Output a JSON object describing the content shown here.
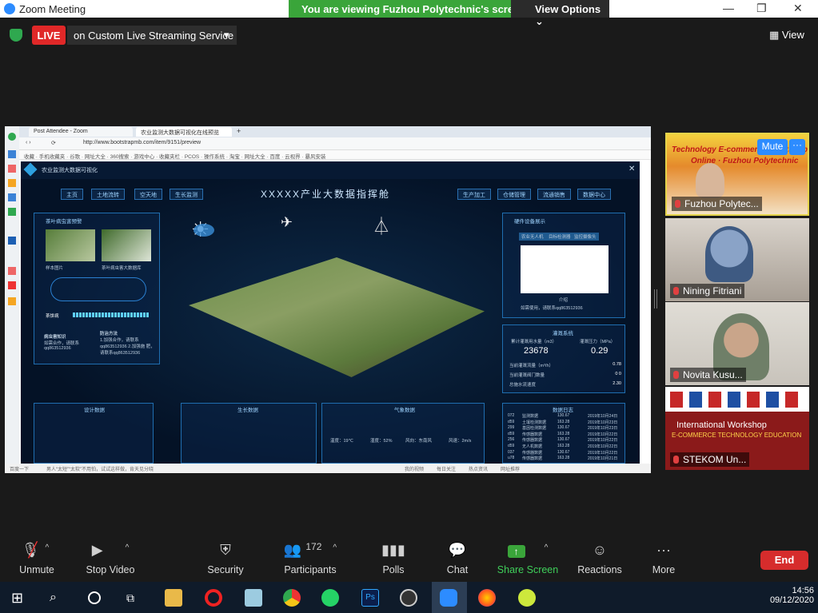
{
  "window": {
    "title": "Zoom Meeting",
    "viewing_banner": "You are viewing Fuzhou Polytechnic's screen",
    "view_options": "View Options",
    "view_button": "View"
  },
  "live": {
    "badge": "LIVE",
    "service": "on Custom Live Streaming Service"
  },
  "browser": {
    "tabs": [
      "Post Attendee - Zoom",
      "农业监测大数据可视化在线预览"
    ],
    "url": "http://www.bootstrapmb.com/item/9151/preview",
    "bookmarks": [
      "收藏",
      "手机收藏夹",
      "谷歌",
      "网址大全",
      "360搜索",
      "游戏中心",
      "收藏夹栏",
      "PCOS",
      "操作系统",
      "淘宝",
      "网址大全",
      "百度",
      "云视界",
      "暴风安装"
    ],
    "status": [
      "百度一下",
      "男人“太短”“太软”不用怕，试试这样做，肯天见分晓",
      "我的视频",
      "每日关注",
      "热点资讯",
      "网址推荐"
    ]
  },
  "dashboard": {
    "brand": "农业监测大数据可视化",
    "nav_left": [
      "主页",
      "土地流转",
      "空天地",
      "生长监测"
    ],
    "title": "XXXXX产业大数据指挥舱",
    "nav_right": [
      "生产加工",
      "仓储管理",
      "流通销售",
      "数据中心"
    ],
    "left_panel": {
      "title": "茶叶病虫害预警",
      "img1": "样本图片",
      "img2": "茶叶病虫害大数据库",
      "disease": "茶饼病",
      "box1_title": "病虫害知识",
      "box1_text": "如需合作，请联系 qq863512936",
      "box2_title": "防治方法",
      "box2_text": "1.加强合作，请联系 qq863512936 2.加强施 肥，请联系qq863512936"
    },
    "right_panel": {
      "title": "硬件设备展示",
      "tabs": [
        "农业无人机",
        "目标检测器",
        "监控摄像头"
      ],
      "caption": "介绍",
      "desc": "如需使用，请联系qq863512936"
    },
    "metrics": {
      "title": "灌溉系统",
      "water_label": "累计灌溉用水量（m3）",
      "water_value": "23678",
      "pressure_label": "灌溉压力（MPa）",
      "pressure_value": "0.29",
      "rows": [
        {
          "label": "当前灌溉流量（m³/h）",
          "value": "0.78"
        },
        {
          "label": "当前灌溉阀门数量",
          "value": "0 0"
        },
        {
          "label": "总施水流速度",
          "value": "2.30"
        }
      ]
    },
    "table": {
      "title": "数据日志",
      "rows": [
        [
          "072",
          "监测数据",
          "130.67",
          "2019年10月24日"
        ],
        [
          "d59",
          "土壤检测数据",
          "163.28",
          "2019年10月23日"
        ],
        [
          "299",
          "基因检测数据",
          "130.67",
          "2019年10月23日"
        ],
        [
          "d59",
          "传感器数据",
          "163.28",
          "2019年10月22日"
        ],
        [
          "256",
          "传感器数据",
          "130.67",
          "2019年10月22日"
        ],
        [
          "d59",
          "无人机数据",
          "163.28",
          "2019年10月22日"
        ],
        [
          "037",
          "传感器数据",
          "130.67",
          "2019年10月22日"
        ],
        [
          "u78",
          "传感器数据",
          "163.28",
          "2019年10月21日"
        ]
      ]
    },
    "bottom": {
      "p1": "设计数据",
      "p2": "生长数据",
      "p3": "气象数据",
      "weather": [
        "温度：19℃",
        "湿度：52%",
        "风向：东南风",
        "风速：2m/s"
      ]
    }
  },
  "participants": [
    {
      "name": "Fuzhou Polytec...",
      "mute_label": "Mute"
    },
    {
      "name": "Nining Fitriani"
    },
    {
      "name": "Novita Kusu..."
    },
    {
      "name": "STEKOM Un..."
    }
  ],
  "banner_lines": [
    "Technology E-commerce Workshop",
    "Online · Fuzhou Polytechnic",
    "International Workshop",
    "E-COMMERCE TECHNOLOGY EDUCATION"
  ],
  "toolbar": [
    {
      "label": "Unmute",
      "icon": "mic-muted-icon"
    },
    {
      "label": "Stop Video",
      "icon": "video-icon"
    },
    {
      "label": "Security",
      "icon": "shield-icon"
    },
    {
      "label": "Participants",
      "icon": "people-icon",
      "count": "172"
    },
    {
      "label": "Polls",
      "icon": "poll-icon"
    },
    {
      "label": "Chat",
      "icon": "chat-icon"
    },
    {
      "label": "Share Screen",
      "icon": "share-screen-icon"
    },
    {
      "label": "Reactions",
      "icon": "reaction-icon"
    },
    {
      "label": "More",
      "icon": "more-icon"
    }
  ],
  "end_label": "End",
  "clock": {
    "time": "14:56",
    "date": "09/12/2020"
  },
  "colors": {
    "live": "#e02828",
    "share": "#3aa53a",
    "end": "#d62c2c",
    "accent": "#2d8cff"
  }
}
